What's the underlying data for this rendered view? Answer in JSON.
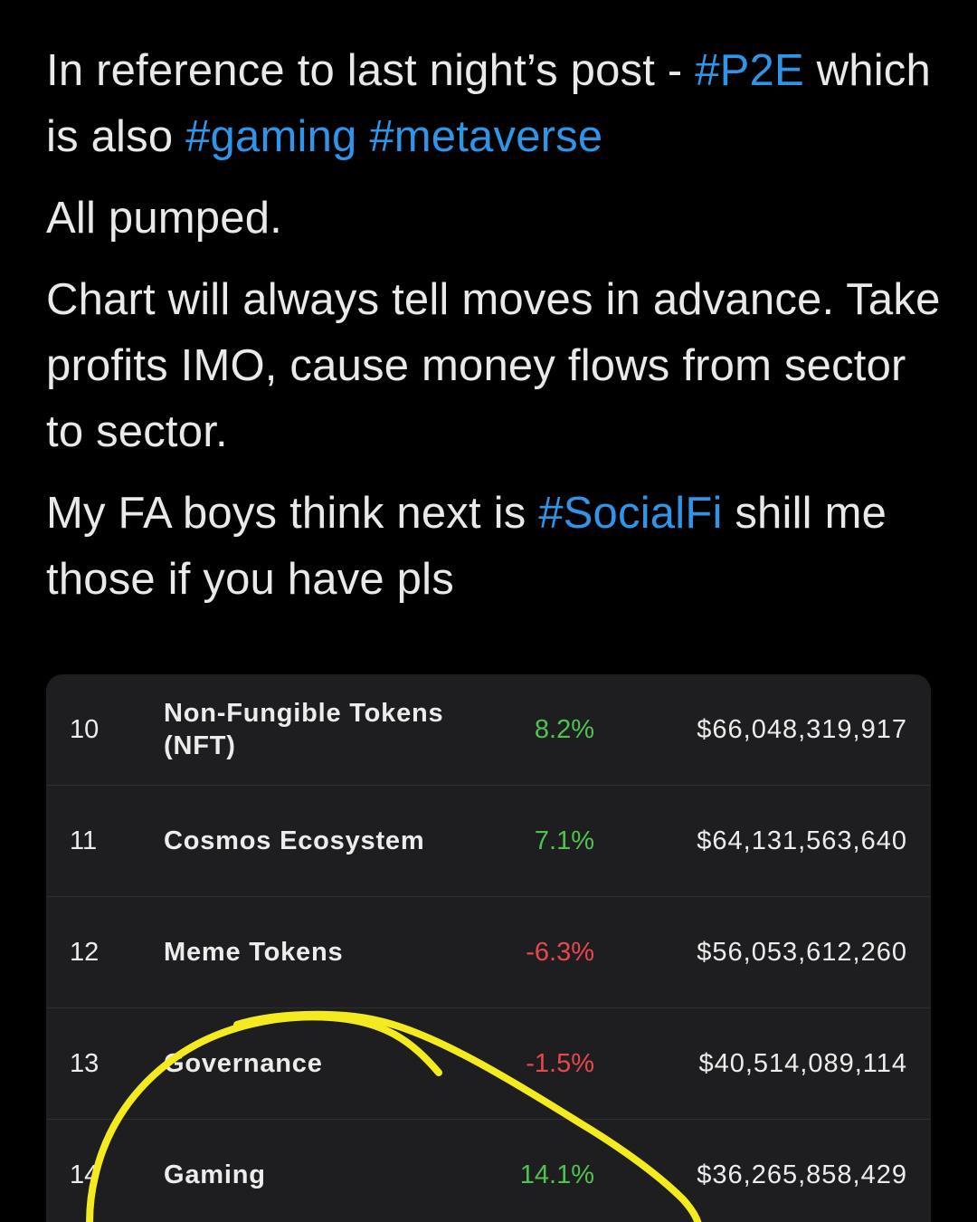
{
  "tweet": {
    "paragraphs": [
      [
        {
          "text": "In reference to last night’s post - "
        },
        {
          "text": "#P2E",
          "hashtag": true
        },
        {
          "text": " which is also "
        },
        {
          "text": "#gaming",
          "hashtag": true
        },
        {
          "text": " "
        },
        {
          "text": "#metaverse",
          "hashtag": true
        }
      ],
      [
        {
          "text": "All pumped."
        }
      ],
      [
        {
          "text": "Chart will always tell moves in advance. Take profits IMO, cause money flows from sector to sector."
        }
      ],
      [
        {
          "text": "My FA boys think next is "
        },
        {
          "text": "#SocialFi",
          "hashtag": true
        },
        {
          "text": " shill me those if you have pls"
        }
      ]
    ]
  },
  "table": {
    "rows": [
      {
        "rank": "10",
        "name": "Non-Fungible Tokens (NFT)",
        "change": "8.2%",
        "market_cap": "$66,048,319,917"
      },
      {
        "rank": "11",
        "name": "Cosmos Ecosystem",
        "change": "7.1%",
        "market_cap": "$64,131,563,640"
      },
      {
        "rank": "12",
        "name": "Meme Tokens",
        "change": "-6.3%",
        "market_cap": "$56,053,612,260"
      },
      {
        "rank": "13",
        "name": "Governance",
        "change": "-1.5%",
        "market_cap": "$40,514,089,114"
      },
      {
        "rank": "14",
        "name": "Gaming",
        "change": "14.1%",
        "market_cap": "$36,265,858,429"
      }
    ]
  },
  "colors": {
    "positive": "#4fc24f",
    "negative": "#e5484d",
    "hashtag": "#2f95e8",
    "highlight_scribble": "#f4ea20"
  }
}
